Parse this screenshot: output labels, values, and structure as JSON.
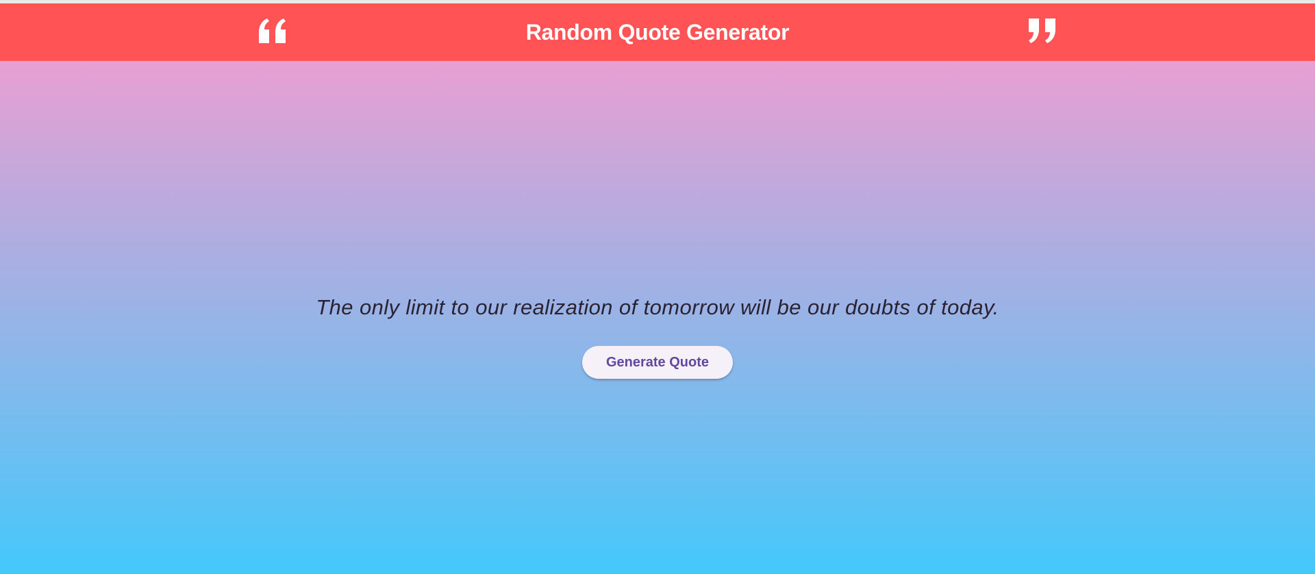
{
  "app": {
    "title": "Random Quote Generator",
    "accent_color": "#ff5355",
    "left_icon": "open-quote-icon",
    "right_icon": "close-quote-icon"
  },
  "main": {
    "quote": "The only limit to our realization of tomorrow will be our doubts of today.",
    "button_label": "Generate Quote",
    "gradient_colors": [
      "#fb9bce",
      "#b3acdf",
      "#8cb7ea",
      "#44c8fb"
    ]
  }
}
